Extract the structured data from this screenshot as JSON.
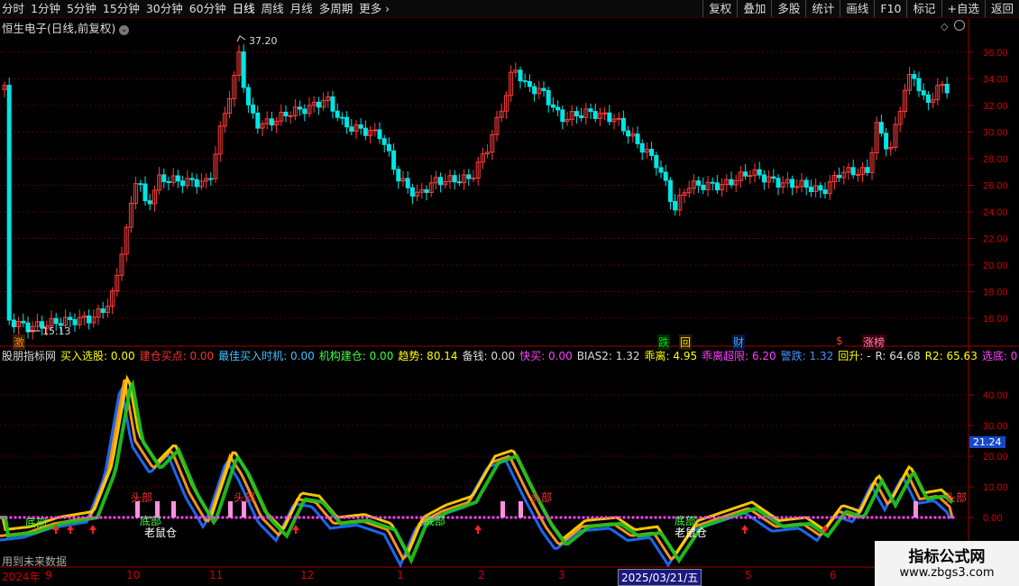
{
  "toolbar": {
    "periods": [
      "分时",
      "1分钟",
      "5分钟",
      "15分钟",
      "30分钟",
      "60分钟",
      "日线",
      "周线",
      "月线",
      "多周期",
      "更多"
    ],
    "active_period": "日线",
    "right_buttons": [
      "复权",
      "叠加",
      "多股",
      "统计",
      "画线",
      "F10",
      "标记",
      "+自选",
      "返回"
    ]
  },
  "stock": {
    "title": "恒生电子(日线,前复权)"
  },
  "price_axis": {
    "ticks": [
      "36.00",
      "34.00",
      "32.00",
      "30.00",
      "28.00",
      "26.00",
      "24.00",
      "22.00",
      "20.00",
      "18.00",
      "16.00"
    ]
  },
  "price_annotations": {
    "high": "37.20",
    "low": "15.13"
  },
  "event_tags": [
    {
      "text": "激",
      "color": "#ff8000",
      "bg": "#3a2000"
    },
    {
      "text": "跌",
      "color": "#00e000",
      "bg": "#002a00"
    },
    {
      "text": "回",
      "color": "#ffd000",
      "bg": "#2a2000"
    },
    {
      "text": "财",
      "color": "#4aa0ff",
      "bg": "#00183a"
    },
    {
      "text": "$",
      "color": "#ff3030",
      "bg": "#000"
    },
    {
      "text": "涨榜",
      "color": "#ff80a0",
      "bg": "#3a0010"
    }
  ],
  "indicator": {
    "name": "股朋指标网",
    "items": [
      {
        "label": "买入选股:",
        "value": "0.00",
        "color": "#ffff00"
      },
      {
        "label": "建仓买点:",
        "value": "0.00",
        "color": "#ff3030"
      },
      {
        "label": "最佳买入时机:",
        "value": "0.00",
        "color": "#40c0ff"
      },
      {
        "label": "机构建仓:",
        "value": "0.00",
        "color": "#40ff40"
      },
      {
        "label": "趋势:",
        "value": "80.14",
        "color": "#ffff00"
      },
      {
        "label": "备钱:",
        "value": "0.00",
        "color": "#dddddd"
      },
      {
        "label": "快买:",
        "value": "0.00",
        "color": "#ff40ff"
      },
      {
        "label": "BIAS2:",
        "value": "1.32",
        "color": "#dddddd"
      },
      {
        "label": "乖离:",
        "value": "4.95",
        "color": "#ffff00"
      },
      {
        "label": "乖离超限:",
        "value": "6.20",
        "color": "#ff40ff"
      },
      {
        "label": "警跌:",
        "value": "1.32",
        "color": "#4a8cff"
      },
      {
        "label": "回升:",
        "value": "-",
        "color": "#ffff00"
      },
      {
        "label": "R:",
        "value": "64.68",
        "color": "#dddddd"
      },
      {
        "label": "R2:",
        "value": "65.63",
        "color": "#ffff00"
      },
      {
        "label": "选底:",
        "value": "0",
        "color": "#ff40ff"
      }
    ],
    "axis_ticks": [
      "40.00",
      "30.00",
      "20.00",
      "10.00",
      "0.00"
    ],
    "current_value": "21.24",
    "labels": {
      "top": "头部",
      "bottom": "底部",
      "rat": "老鼠仓"
    }
  },
  "date_axis": {
    "labels": [
      "2024年",
      "9",
      "10",
      "11",
      "12",
      "1",
      "2",
      "3",
      "2025/03/21/五",
      "5",
      "6"
    ]
  },
  "footer": {
    "future_note": "用到未来数据"
  },
  "watermark": {
    "title": "指标公式网",
    "url": "www.zbgs3.com"
  },
  "colors": {
    "up": "#ff3c3c",
    "down": "#00e5e5",
    "grid": "#8b0000",
    "accent": "#ffff00"
  }
}
